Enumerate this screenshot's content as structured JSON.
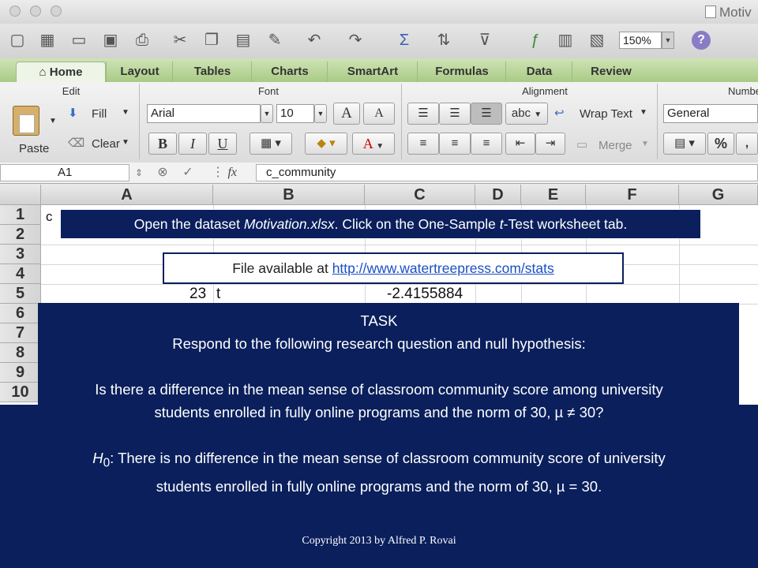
{
  "window": {
    "title": "Motiv"
  },
  "toolbar": {
    "zoom": "150%"
  },
  "ribbon_tabs": [
    {
      "label": "Home"
    },
    {
      "label": "Layout"
    },
    {
      "label": "Tables"
    },
    {
      "label": "Charts"
    },
    {
      "label": "SmartArt"
    },
    {
      "label": "Formulas"
    },
    {
      "label": "Data"
    },
    {
      "label": "Review"
    }
  ],
  "ribbon": {
    "edit": {
      "label": "Edit",
      "paste": "Paste",
      "fill": "Fill",
      "clear": "Clear"
    },
    "font": {
      "label": "Font",
      "name": "Arial",
      "size": "10",
      "bold": "B",
      "italic": "I",
      "underline": "U",
      "grow": "A",
      "shrink": "A",
      "color_a": "A"
    },
    "alignment": {
      "label": "Alignment",
      "abc": "abc",
      "wrap_text": "Wrap Text",
      "merge": "Merge"
    },
    "number": {
      "label": "Numbe",
      "format": "General",
      "percent": "%",
      "comma": ","
    }
  },
  "formula_bar": {
    "cell_ref": "A1",
    "fx": "fx",
    "content": "c_community"
  },
  "grid": {
    "columns": [
      "A",
      "B",
      "C",
      "D",
      "E",
      "F",
      "G"
    ],
    "rows": [
      "1",
      "2",
      "3",
      "4",
      "5",
      "6",
      "7",
      "8",
      "9",
      "10"
    ],
    "cell_a1": "c",
    "row5": {
      "a": "23",
      "b": "t",
      "c": "-2.4155884"
    }
  },
  "overlay": {
    "instruction": {
      "t1": "Open the dataset ",
      "t2": "Motivation.xlsx",
      "t3": ". Click on the One-Sample ",
      "t4": "t",
      "t5": "-Test worksheet tab."
    },
    "file_prefix": "File available at ",
    "file_url": "http://www.watertreepress.com/stats",
    "task_title": "TASK",
    "task_intro": "Respond to the following research question and null hypothesis:",
    "question_l1": "Is there a difference in the mean sense of classroom community score among university",
    "question_l2": "students enrolled in fully online programs and the norm of 30, µ ≠ 30?",
    "h0_symbol": "H",
    "h0_sub": "0",
    "h0_l1": ": There is no difference in the mean sense of classroom community score of university",
    "h0_l2": "students enrolled in fully online programs and the norm of 30, µ = 30.",
    "copyright": "Copyright 2013 by Alfred P. Rovai"
  },
  "colors": {
    "panel": "#0a1f5c",
    "ribbon_tab": "#b8d49a",
    "link": "#1a4fc4"
  }
}
